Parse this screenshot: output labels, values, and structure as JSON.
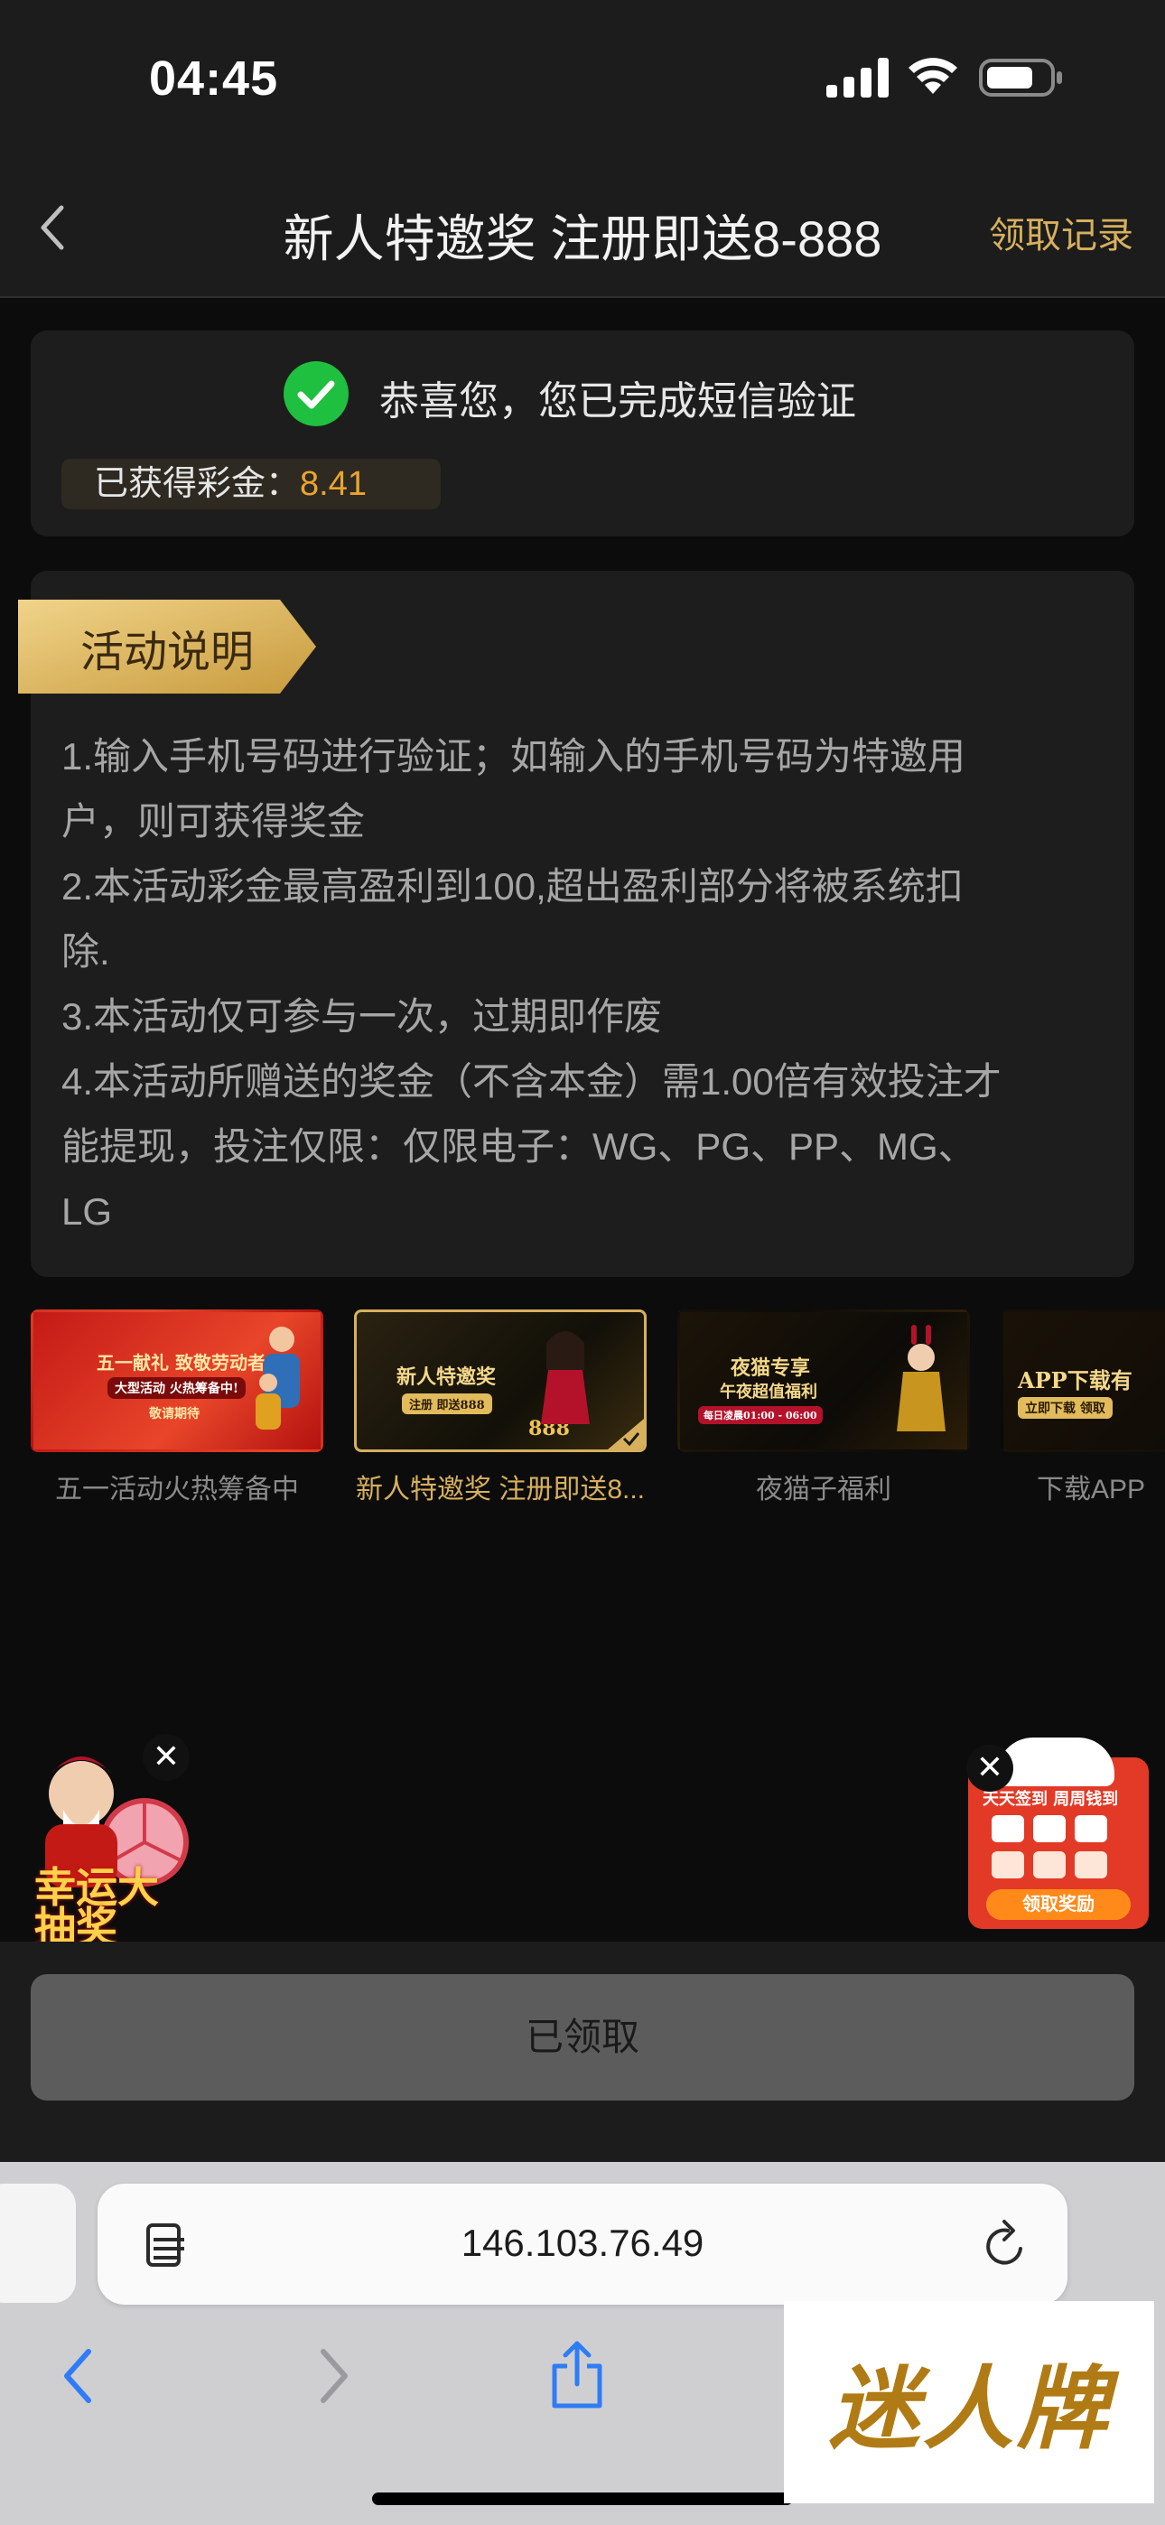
{
  "status_bar": {
    "time": "04:45"
  },
  "nav": {
    "title": "新人特邀奖 注册即送8-888",
    "record_link": "领取记录"
  },
  "verify": {
    "message": "恭喜您，您已完成短信验证",
    "bonus_label": "已获得彩金：",
    "bonus_value": "8.41"
  },
  "rules": {
    "heading": "活动说明",
    "items": [
      "1.输入手机号码进行验证；如输入的手机号码为特邀用",
      "户，则可获得奖金",
      "2.本活动彩金最高盈利到100,超出盈利部分将被系统扣",
      "除.",
      "3.本活动仅可参与一次，过期即作废",
      "4.本活动所赠送的奖金（不含本金）需1.00倍有效投注才",
      "能提现，投注仅限：仅限电子：WG、PG、PP、MG、",
      "LG"
    ]
  },
  "promos": [
    {
      "label": "五一活动火热筹备中",
      "thumb_title": "五一献礼 致敬劳动者",
      "thumb_badge": "大型活动 火热筹备中!",
      "thumb_sub": "敬请期待",
      "active": false
    },
    {
      "label": "新人特邀奖 注册即送8...",
      "thumb_title": "新人特邀奖",
      "thumb_badge": "注册 即送888",
      "thumb_sub": "888",
      "active": true
    },
    {
      "label": "夜猫子福利",
      "thumb_title": "夜猫专享",
      "thumb_badge": "午夜超值福利",
      "thumb_sub": "每日凌晨01:00 - 06:00",
      "active": false
    },
    {
      "label": "下载APP",
      "thumb_title": "APP下载有",
      "thumb_badge": "立即下载 领取",
      "thumb_sub": "",
      "active": false
    }
  ],
  "floats": {
    "left_text": "幸运大抽奖",
    "right_title": "天天签到 周周钱到",
    "right_button": "领取奖励",
    "close_symbol": "✕"
  },
  "claim_button": {
    "label": "已领取"
  },
  "browser": {
    "url": "146.103.76.49"
  },
  "watermark": {
    "text": "迷人牌"
  },
  "colors": {
    "accent_gold": "#d7b05d",
    "bonus_orange": "#e9a52e",
    "success_green": "#1fbf3f"
  }
}
